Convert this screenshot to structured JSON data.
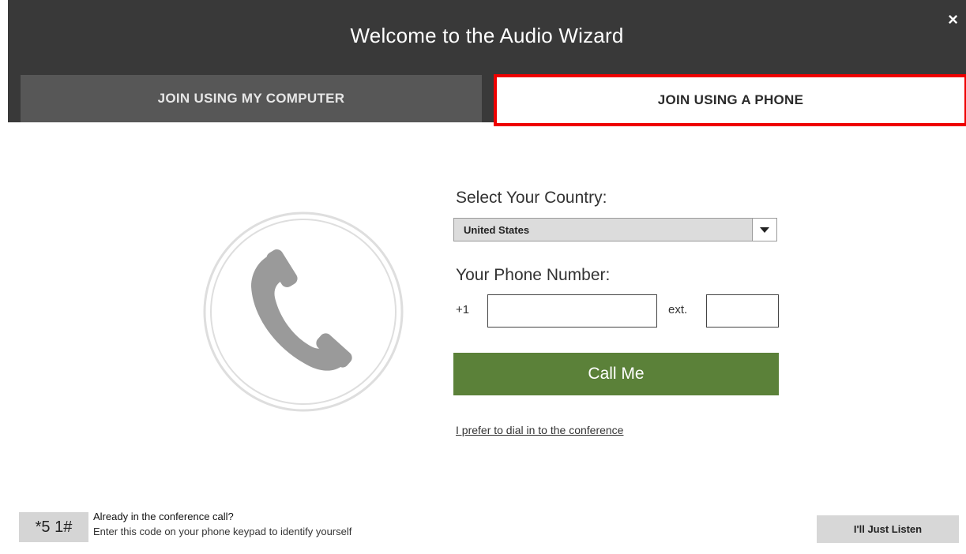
{
  "dialog": {
    "title": "Welcome to the Audio Wizard",
    "close_symbol": "×"
  },
  "tabs": [
    {
      "label": "JOIN USING MY COMPUTER",
      "selected": false
    },
    {
      "label": "JOIN USING A PHONE",
      "selected": true
    }
  ],
  "phone_icon": "phone-handset-icon",
  "form": {
    "country_label": "Select Your Country:",
    "country_value": "United States",
    "phone_label": "Your Phone Number:",
    "country_code": "+1",
    "phone_value": "",
    "ext_label": "ext.",
    "ext_value": "",
    "call_button": "Call Me",
    "dial_in_link": "I prefer to dial in to the conference"
  },
  "footer": {
    "code": "*5 1#",
    "already_text": "Already in the conference call?",
    "instruction": "Enter this code on your phone keypad to identify yourself",
    "listen_button": "I'll Just Listen"
  },
  "colors": {
    "header_bg": "#393939",
    "tab_inactive_bg": "#575757",
    "highlight_border": "#ee0000",
    "call_button_bg": "#5b8139"
  }
}
